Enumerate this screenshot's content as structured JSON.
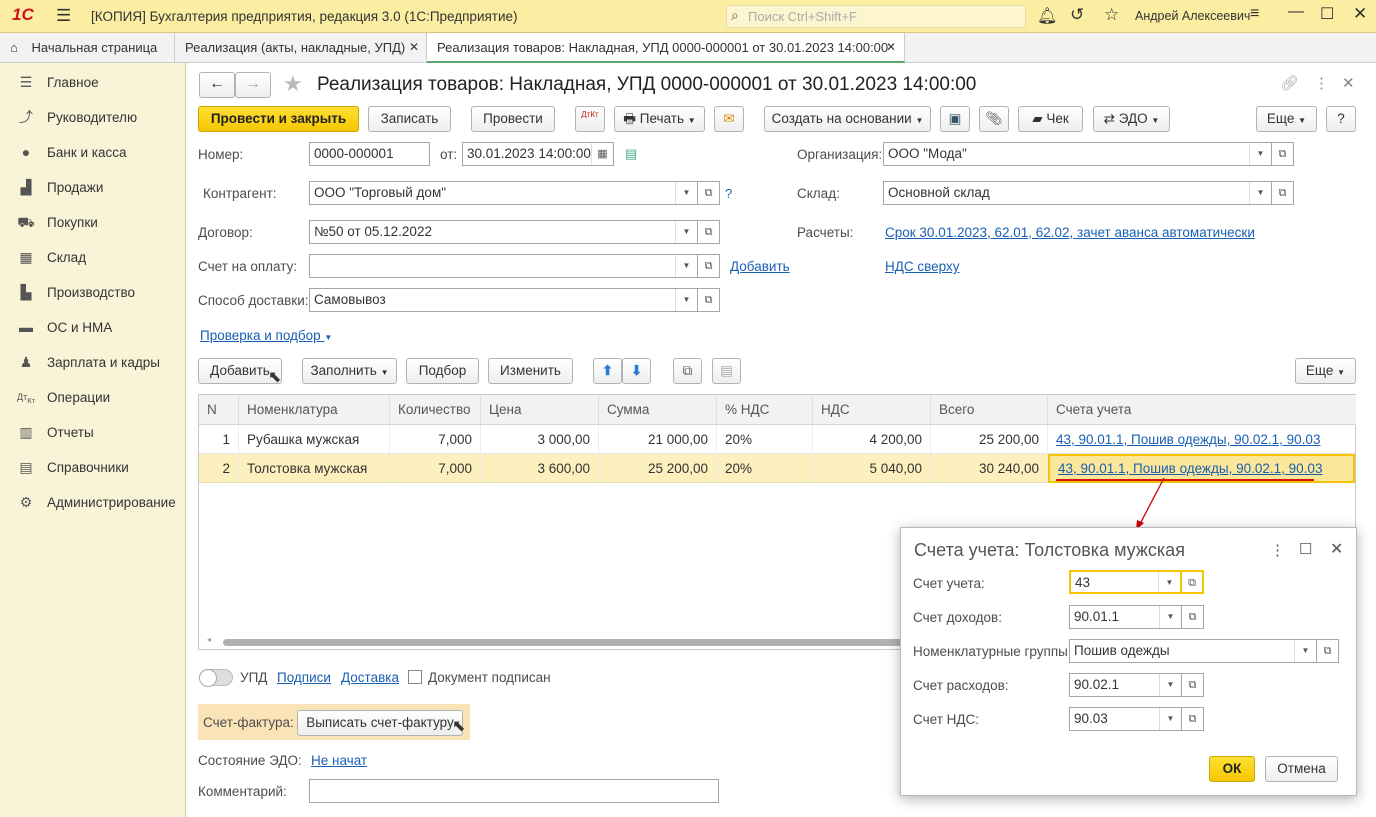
{
  "app": {
    "title": "[КОПИЯ] Бухгалтерия предприятия, редакция 3.0  (1С:Предприятие)",
    "search_placeholder": "Поиск Ctrl+Shift+F",
    "user": "Андрей Алексеевич"
  },
  "tabs": [
    {
      "label": "Начальная страница"
    },
    {
      "label": "Реализация (акты, накладные, УПД)"
    },
    {
      "label": "Реализация товаров: Накладная, УПД 0000-000001 от 30.01.2023 14:00:00"
    }
  ],
  "sidebar": {
    "items": [
      {
        "label": "Главное",
        "icon": "menu-icon"
      },
      {
        "label": "Руководителю",
        "icon": "trend-icon"
      },
      {
        "label": "Банк и касса",
        "icon": "coin-icon"
      },
      {
        "label": "Продажи",
        "icon": "bag-icon"
      },
      {
        "label": "Покупки",
        "icon": "cart-icon"
      },
      {
        "label": "Склад",
        "icon": "warehouse-icon"
      },
      {
        "label": "Производство",
        "icon": "factory-icon"
      },
      {
        "label": "ОС и НМА",
        "icon": "truck-icon"
      },
      {
        "label": "Зарплата и кадры",
        "icon": "person-icon"
      },
      {
        "label": "Операции",
        "icon": "dtkt-icon"
      },
      {
        "label": "Отчеты",
        "icon": "chart-icon"
      },
      {
        "label": "Справочники",
        "icon": "book-icon"
      },
      {
        "label": "Администрирование",
        "icon": "gear-icon"
      }
    ]
  },
  "doc": {
    "title": "Реализация товаров: Накладная, УПД 0000-000001 от 30.01.2023 14:00:00"
  },
  "toolbar": {
    "post_close": "Провести и закрыть",
    "save": "Записать",
    "post": "Провести",
    "dtkt": "ДтКт",
    "print": "Печать",
    "create_based": "Создать на основании",
    "check": "Чек",
    "edo": "ЭДО",
    "more": "Еще",
    "help": "?"
  },
  "form": {
    "number_label": "Номер:",
    "number": "0000-000001",
    "from_label": "от:",
    "date": "30.01.2023 14:00:00",
    "org_label": "Организация:",
    "org": "ООО \"Мода\"",
    "counterparty_label": "Контрагент:",
    "counterparty": "ООО \"Торговый дом\"",
    "q": "?",
    "warehouse_label": "Склад:",
    "warehouse": "Основной склад",
    "contract_label": "Договор:",
    "contract": "№50 от 05.12.2022",
    "settlements_label": "Расчеты:",
    "settlements": "Срок 30.01.2023, 62.01, 62.02, зачет аванса автоматически",
    "invoice_label": "Счет на оплату:",
    "invoice": "",
    "add_link": "Добавить",
    "vat_link": "НДС сверху",
    "delivery_label": "Способ доставки:",
    "delivery": "Самовывоз",
    "check_select": "Проверка и подбор"
  },
  "table_toolbar": {
    "add": "Добавить",
    "fill": "Заполнить",
    "select": "Подбор",
    "change": "Изменить",
    "more": "Еще"
  },
  "table": {
    "headers": [
      "N",
      "Номенклатура",
      "Количество",
      "Цена",
      "Сумма",
      "% НДС",
      "НДС",
      "Всего",
      "Счета учета"
    ],
    "rows": [
      [
        "1",
        "Рубашка мужская",
        "7,000",
        "3 000,00",
        "21 000,00",
        "20%",
        "4 200,00",
        "25 200,00",
        "43, 90.01.1, Пошив одежды, 90.02.1, 90.03"
      ],
      [
        "2",
        "Толстовка мужская",
        "7,000",
        "3 600,00",
        "25 200,00",
        "20%",
        "5 040,00",
        "30 240,00",
        "43, 90.01.1, Пошив одежды, 90.02.1, 90.03"
      ]
    ]
  },
  "footer": {
    "upd": "УПД",
    "signatures": "Подписи",
    "delivery": "Доставка",
    "signed": "Документ подписан",
    "invoice_label": "Счет-фактура:",
    "invoice_btn": "Выписать счет-фактуру",
    "edo_label": "Состояние ЭДО:",
    "edo_status": "Не начат",
    "comment_label": "Комментарий:",
    "comment": ""
  },
  "dialog": {
    "title": "Счета учета: Толстовка мужская",
    "account_label": "Счет учета:",
    "account": "43",
    "income_label": "Счет доходов:",
    "income": "90.01.1",
    "group_label": "Номенклатурные группы:",
    "group": "Пошив одежды",
    "expense_label": "Счет расходов:",
    "expense": "90.02.1",
    "vat_label": "Счет НДС:",
    "vat": "90.03",
    "ok": "ОК",
    "cancel": "Отмена"
  },
  "colors": {
    "title_bg": "#fbeda2",
    "accent_yellow": "#f5c600",
    "link": "#1a5fb4",
    "selected_row": "#fcf0bf"
  }
}
